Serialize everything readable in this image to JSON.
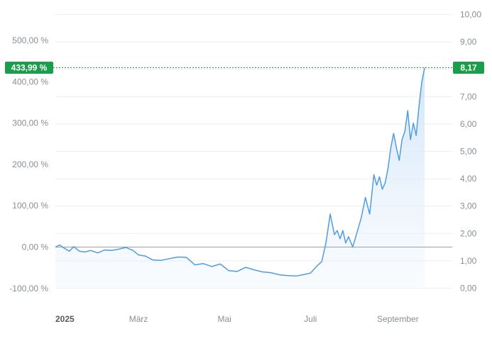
{
  "chart_data": {
    "type": "area",
    "title": "",
    "xlabel": "",
    "ylabel": "",
    "x_tick_labels": [
      "2025",
      "März",
      "Mai",
      "Juli",
      "September"
    ],
    "left_axis": {
      "unit": "percent",
      "ticks": [
        -100,
        0,
        100,
        200,
        300,
        400,
        500
      ],
      "tick_labels": [
        "-100,00 %",
        "0,00 %",
        "100,00 %",
        "200,00 %",
        "300,00 %",
        "400,00 %",
        "500,00 %"
      ]
    },
    "right_axis": {
      "ticks": [
        0,
        1,
        2,
        3,
        4,
        5,
        6,
        7,
        8,
        9,
        10
      ],
      "tick_labels": [
        "0,00",
        "1,00",
        "2,00",
        "3,00",
        "4,00",
        "5,00",
        "6,00",
        "7,00",
        "8,00",
        "9,00",
        "10,00"
      ],
      "range": [
        0,
        10
      ]
    },
    "baseline_price": 1.53,
    "last_value_labels": {
      "percent": "433,99 %",
      "price": "8,17"
    },
    "last_value": {
      "percent": 433.99,
      "price": 8.17
    },
    "colors": {
      "line": "#4f9de0",
      "fill_top": "#cfe3f8",
      "badge": "#1a9e4b",
      "zero_line": "#9aa0a6"
    },
    "series": [
      {
        "x": [
          "2025-01-01",
          "2025-01-04",
          "2025-01-07",
          "2025-01-11",
          "2025-01-14",
          "2025-01-18",
          "2025-01-22",
          "2025-01-26",
          "2025-01-31",
          "2025-02-05",
          "2025-02-10",
          "2025-02-15",
          "2025-02-20",
          "2025-02-25",
          "2025-03-01",
          "2025-03-06",
          "2025-03-11",
          "2025-03-17",
          "2025-03-23",
          "2025-03-29",
          "2025-04-04",
          "2025-04-10",
          "2025-04-16",
          "2025-04-22",
          "2025-04-28",
          "2025-05-04",
          "2025-05-10",
          "2025-05-16",
          "2025-05-22",
          "2025-05-28",
          "2025-06-03",
          "2025-06-09",
          "2025-06-15",
          "2025-06-21",
          "2025-06-27",
          "2025-07-01",
          "2025-07-05",
          "2025-07-09",
          "2025-07-12",
          "2025-07-15",
          "2025-07-18",
          "2025-07-20",
          "2025-07-22",
          "2025-07-24",
          "2025-07-26",
          "2025-07-28",
          "2025-07-31",
          "2025-08-03",
          "2025-08-06",
          "2025-08-09",
          "2025-08-12",
          "2025-08-15",
          "2025-08-17",
          "2025-08-19",
          "2025-08-21",
          "2025-08-23",
          "2025-08-25",
          "2025-08-27",
          "2025-08-29",
          "2025-08-31",
          "2025-09-02",
          "2025-09-04",
          "2025-09-06",
          "2025-09-08",
          "2025-09-10",
          "2025-09-12",
          "2025-09-14",
          "2025-09-16",
          "2025-09-18",
          "2025-09-20"
        ],
        "y": [
          0,
          5,
          -2,
          -10,
          1,
          -10,
          -12,
          -8,
          -14,
          -7,
          -8,
          -5,
          -1,
          -8,
          -19,
          -22,
          -31,
          -32,
          -28,
          -24,
          -25,
          -43,
          -40,
          -47,
          -41,
          -57,
          -59,
          -49,
          -55,
          -60,
          -62,
          -67,
          -69,
          -70,
          -66,
          -63,
          -48,
          -35,
          10,
          80,
          30,
          40,
          20,
          40,
          10,
          25,
          0,
          35,
          70,
          120,
          80,
          175,
          150,
          170,
          140,
          155,
          190,
          240,
          275,
          240,
          210,
          260,
          280,
          330,
          260,
          300,
          270,
          340,
          400,
          434
        ]
      }
    ]
  }
}
